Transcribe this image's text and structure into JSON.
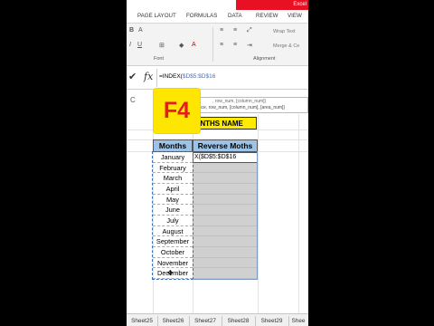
{
  "window": {
    "app_name": "Excel"
  },
  "ribbon_tabs": [
    "PAGE LAYOUT",
    "FORMULAS",
    "DATA",
    "REVIEW",
    "VIEW"
  ],
  "ribbon": {
    "wrap_text": "Wrap Text",
    "merge": "Merge & Ce",
    "font_group": "Font",
    "alignment_group": "Alignment"
  },
  "formula_bar": {
    "check_symbol": "✔",
    "fx_label": "fx",
    "formula_prefix": "=INDEX(",
    "formula_ref": "$D$5:$D$16"
  },
  "tooltip": {
    "line1": ", row_num, [column_num])",
    "line2": "ence, row_num, [column_num], [area_num])"
  },
  "column_header_visible": "C",
  "overlay_key": "F4",
  "sheet_title": "ONTHS NAME",
  "table": {
    "col1_header": "Months",
    "col2_header": "Reverse Moths",
    "active_cell_text": "X($D$5:$D$16",
    "months": [
      "January",
      "February",
      "March",
      "April",
      "May",
      "June",
      "July",
      "August",
      "September",
      "October",
      "November",
      "December"
    ]
  },
  "sheet_tabs": [
    "Sheet25",
    "Sheet26",
    "Sheet27",
    "Sheet28",
    "Sheet29",
    "Shee"
  ],
  "colors": {
    "header_fill": "#9dc3e6",
    "title_fill": "#ffeb00",
    "overlay_fill": "#ffe600",
    "overlay_text": "#e31b23",
    "empty_cell_fill": "#d0d0d0"
  }
}
